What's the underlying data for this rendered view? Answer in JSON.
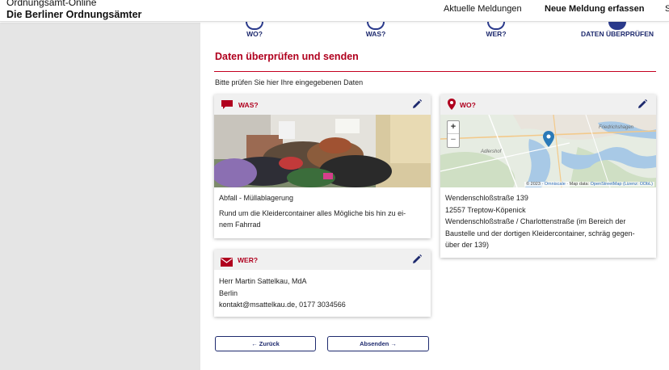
{
  "header": {
    "brand_sub": "Ordnungsamt-Online",
    "brand_main": "Die Berliner Ordnungsämter",
    "nav": [
      {
        "label": "Aktuelle Meldungen"
      },
      {
        "label": "Neue Meldung erfassen"
      },
      {
        "label": "S"
      }
    ]
  },
  "steps": [
    {
      "label": "WO?"
    },
    {
      "label": "WAS?"
    },
    {
      "label": "WER?"
    },
    {
      "label": "DATEN ÜBERPRÜFEN",
      "active": true
    }
  ],
  "main": {
    "title": "Daten überprüfen und senden",
    "intro": "Bitte prüfen Sie hier Ihre eingegebenen Daten"
  },
  "was_card": {
    "title": "WAS?",
    "icon": "speech-bubble-icon",
    "category": "Abfall - Müllablagerung",
    "description_line1": "Rund um die Kleidercontainer alles Mögliche bis hin zu ei-",
    "description_line2": "nem Fahrrad"
  },
  "wo_card": {
    "title": "WO?",
    "icon": "map-pin-icon",
    "address_line1": "Wendenschloßstraße 139",
    "address_line2": "12557 Treptow-Köpenick",
    "detail_line1": "Wendenschloßstraße / Charlottenstraße (im Bereich der",
    "detail_line2": "Baustelle und der dortigen Kleidercontainer, schräg gegen-",
    "detail_line3": "über der 139)",
    "map": {
      "zoom_in": "+",
      "zoom_out": "−",
      "attribution_prefix": "© 2023 ·",
      "attribution_omniscale": "Omniscale",
      "attribution_mapdata": "· Map data:",
      "attribution_osm": "OpenStreetMap (Lizenz: ODbL)",
      "place_label_1": "Friedrichshagen",
      "place_label_2": "Adlershof"
    }
  },
  "wer_card": {
    "title": "WER?",
    "icon": "envelope-icon",
    "name": "Herr Martin Sattelkau, MdA",
    "city": "Berlin",
    "contact": "kontakt@msattelkau.de, 0177 3034566"
  },
  "buttons": {
    "back": "← Zurück",
    "send": "Absenden →"
  },
  "colors": {
    "accent_red": "#b0001e",
    "navy": "#1e2a6e"
  }
}
